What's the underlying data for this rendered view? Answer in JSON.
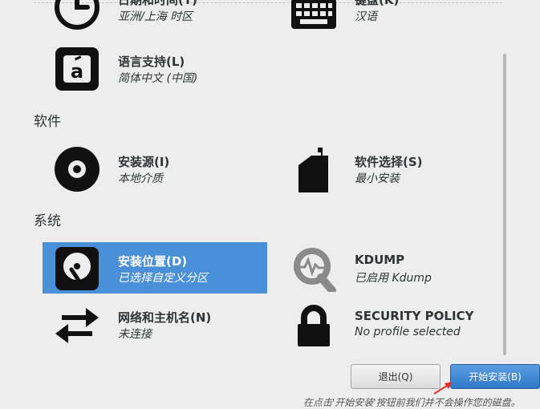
{
  "localization": {
    "datetime": {
      "title": "日期和时间(T)",
      "status": "亚洲/上海 时区"
    },
    "keyboard": {
      "title": "键盘(K)",
      "status": "汉语"
    },
    "language": {
      "title": "语言支持(L)",
      "status": "简体中文 (中国)"
    }
  },
  "software": {
    "heading": "软件",
    "source": {
      "title": "安装源(I)",
      "status": "本地介质"
    },
    "selection": {
      "title": "软件选择(S)",
      "status": "最小安装"
    }
  },
  "system": {
    "heading": "系统",
    "destination": {
      "title": "安装位置(D)",
      "status": "已选择自定义分区"
    },
    "kdump": {
      "title": "KDUMP",
      "status": "已启用 Kdump"
    },
    "network": {
      "title": "网络和主机名(N)",
      "status": "未连接"
    },
    "security": {
      "title": "SECURITY POLICY",
      "status": "No profile selected"
    }
  },
  "buttons": {
    "quit": "退出(Q)",
    "begin": "开始安装(B)"
  },
  "footer_note": "在点击'开始安装'按钮前我们并不会操作您的磁盘。",
  "colors": {
    "selected": "#4a90d9",
    "icon": "#111111",
    "disabled_icon": "#8a8a8a",
    "arrow": "#e0302a"
  },
  "icons": {
    "datetime": "clock-icon",
    "keyboard": "keyboard-icon",
    "language": "language-icon",
    "source": "disc-icon",
    "selection": "package-icon",
    "destination": "harddisk-icon",
    "kdump": "search-icon",
    "network": "network-arrows-icon",
    "security": "lock-icon"
  }
}
